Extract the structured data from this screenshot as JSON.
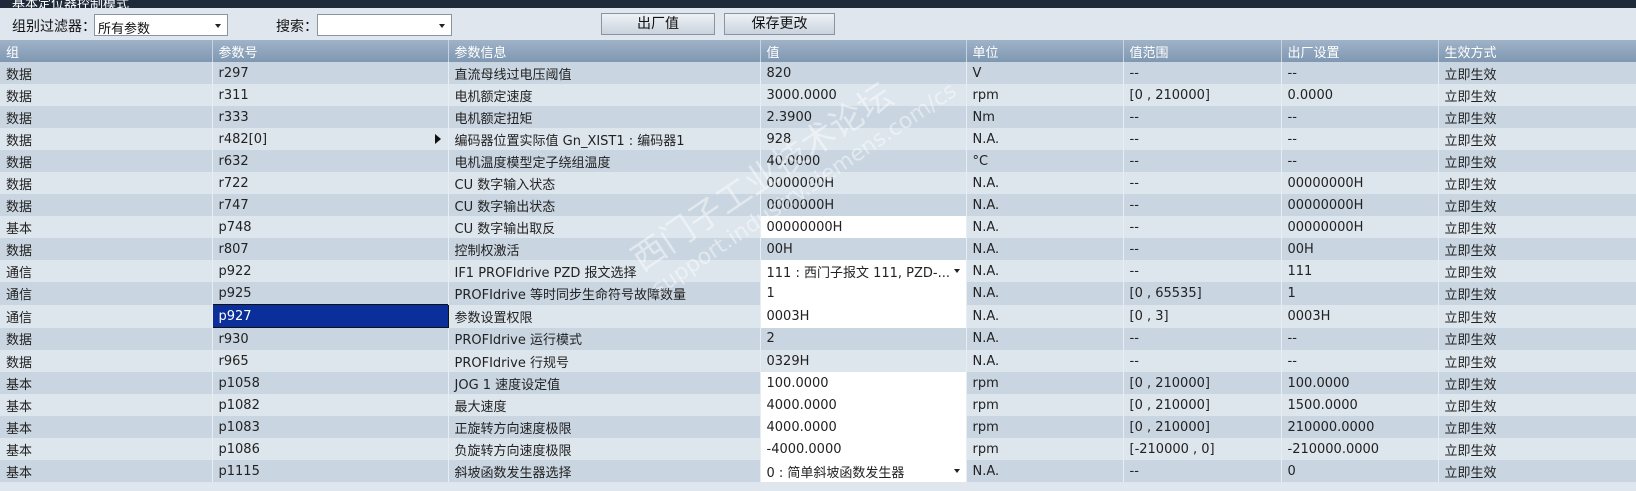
{
  "window": {
    "title": "基本定位器控制模式"
  },
  "toolbar": {
    "group_filter_label": "组别过滤器：",
    "group_filter_value": "所有参数",
    "search_label": "搜索：",
    "search_value": "",
    "factory_button": "出厂值",
    "save_button": "保存更改"
  },
  "columns": [
    "组",
    "参数号",
    "参数信息",
    "值",
    "单位",
    "值范围",
    "出厂设置",
    "生效方式"
  ],
  "rows": [
    {
      "group": "数据",
      "param": "r297",
      "info": "直流母线过电压阈值",
      "value": "820",
      "unit": "V",
      "range": "--",
      "factory": "--",
      "effect": "立即生效"
    },
    {
      "group": "数据",
      "param": "r311",
      "info": "电机额定速度",
      "value": "3000.0000",
      "unit": "rpm",
      "range": "[0 , 210000]",
      "factory": "0.0000",
      "effect": "立即生效"
    },
    {
      "group": "数据",
      "param": "r333",
      "info": "电机额定扭矩",
      "value": "2.3900",
      "unit": "Nm",
      "range": "--",
      "factory": "--",
      "effect": "立即生效"
    },
    {
      "group": "数据",
      "param": "r482[0]",
      "info": "编码器位置实际值 Gn_XIST1 : 编码器1",
      "value": "928",
      "unit": "N.A.",
      "range": "--",
      "factory": "--",
      "effect": "立即生效"
    },
    {
      "group": "数据",
      "param": "r632",
      "info": "电机温度模型定子绕组温度",
      "value": "40.0000",
      "unit": "°C",
      "range": "--",
      "factory": "--",
      "effect": "立即生效"
    },
    {
      "group": "数据",
      "param": "r722",
      "info": "CU 数字输入状态",
      "value": "0000000H",
      "unit": "N.A.",
      "range": "--",
      "factory": "00000000H",
      "effect": "立即生效"
    },
    {
      "group": "数据",
      "param": "r747",
      "info": "CU 数字输出状态",
      "value": "0000000H",
      "unit": "N.A.",
      "range": "--",
      "factory": "00000000H",
      "effect": "立即生效"
    },
    {
      "group": "基本",
      "param": "p748",
      "info": "CU 数字输出取反",
      "value": "00000000H",
      "unit": "N.A.",
      "range": "--",
      "factory": "00000000H",
      "effect": "立即生效"
    },
    {
      "group": "数据",
      "param": "r807",
      "info": "控制权激活",
      "value": "00H",
      "unit": "N.A.",
      "range": "--",
      "factory": "00H",
      "effect": "立即生效"
    },
    {
      "group": "通信",
      "param": "p922",
      "info": "IF1 PROFIdrive PZD 报文选择",
      "value": "111 : 西门子报文 111, PZD-...",
      "unit": "N.A.",
      "range": "--",
      "factory": "111",
      "effect": "立即生效"
    },
    {
      "group": "通信",
      "param": "p925",
      "info": "PROFIdrive 等时同步生命符号故障数量",
      "value": "1",
      "unit": "N.A.",
      "range": "[0 , 65535]",
      "factory": "1",
      "effect": "立即生效"
    },
    {
      "group": "通信",
      "param": "p927",
      "info": "参数设置权限",
      "value": "0003H",
      "unit": "N.A.",
      "range": "[0 , 3]",
      "factory": "0003H",
      "effect": "立即生效"
    },
    {
      "group": "数据",
      "param": "r930",
      "info": "PROFIdrive 运行模式",
      "value": "2",
      "unit": "N.A.",
      "range": "--",
      "factory": "--",
      "effect": "立即生效"
    },
    {
      "group": "数据",
      "param": "r965",
      "info": "PROFIdrive 行规号",
      "value": "0329H",
      "unit": "N.A.",
      "range": "--",
      "factory": "--",
      "effect": "立即生效"
    },
    {
      "group": "基本",
      "param": "p1058",
      "info": "JOG 1 速度设定值",
      "value": "100.0000",
      "unit": "rpm",
      "range": "[0 , 210000]",
      "factory": "100.0000",
      "effect": "立即生效"
    },
    {
      "group": "基本",
      "param": "p1082",
      "info": "最大速度",
      "value": "4000.0000",
      "unit": "rpm",
      "range": "[0 , 210000]",
      "factory": "1500.0000",
      "effect": "立即生效"
    },
    {
      "group": "基本",
      "param": "p1083",
      "info": "正旋转方向速度极限",
      "value": "4000.0000",
      "unit": "rpm",
      "range": "[0 , 210000]",
      "factory": "210000.0000",
      "effect": "立即生效"
    },
    {
      "group": "基本",
      "param": "p1086",
      "info": "负旋转方向速度极限",
      "value": "-4000.0000",
      "unit": "rpm",
      "range": "[-210000 , 0]",
      "factory": "-210000.0000",
      "effect": "立即生效"
    },
    {
      "group": "基本",
      "param": "p1115",
      "info": "斜坡函数发生器选择",
      "value": "0 : 简单斜坡函数发生器",
      "unit": "N.A.",
      "range": "--",
      "factory": "0",
      "effect": "立即生效"
    }
  ],
  "watermark": {
    "line1": "西门子工业技术论坛",
    "line2": "support.industry.siemens.com/cs"
  },
  "colors": {
    "header": "#8ea6bf",
    "row_odd": "#c9d5e1",
    "row_even": "#dde5ed",
    "selected": "#0b2f9a",
    "title_bar": "#1e2a3a"
  }
}
